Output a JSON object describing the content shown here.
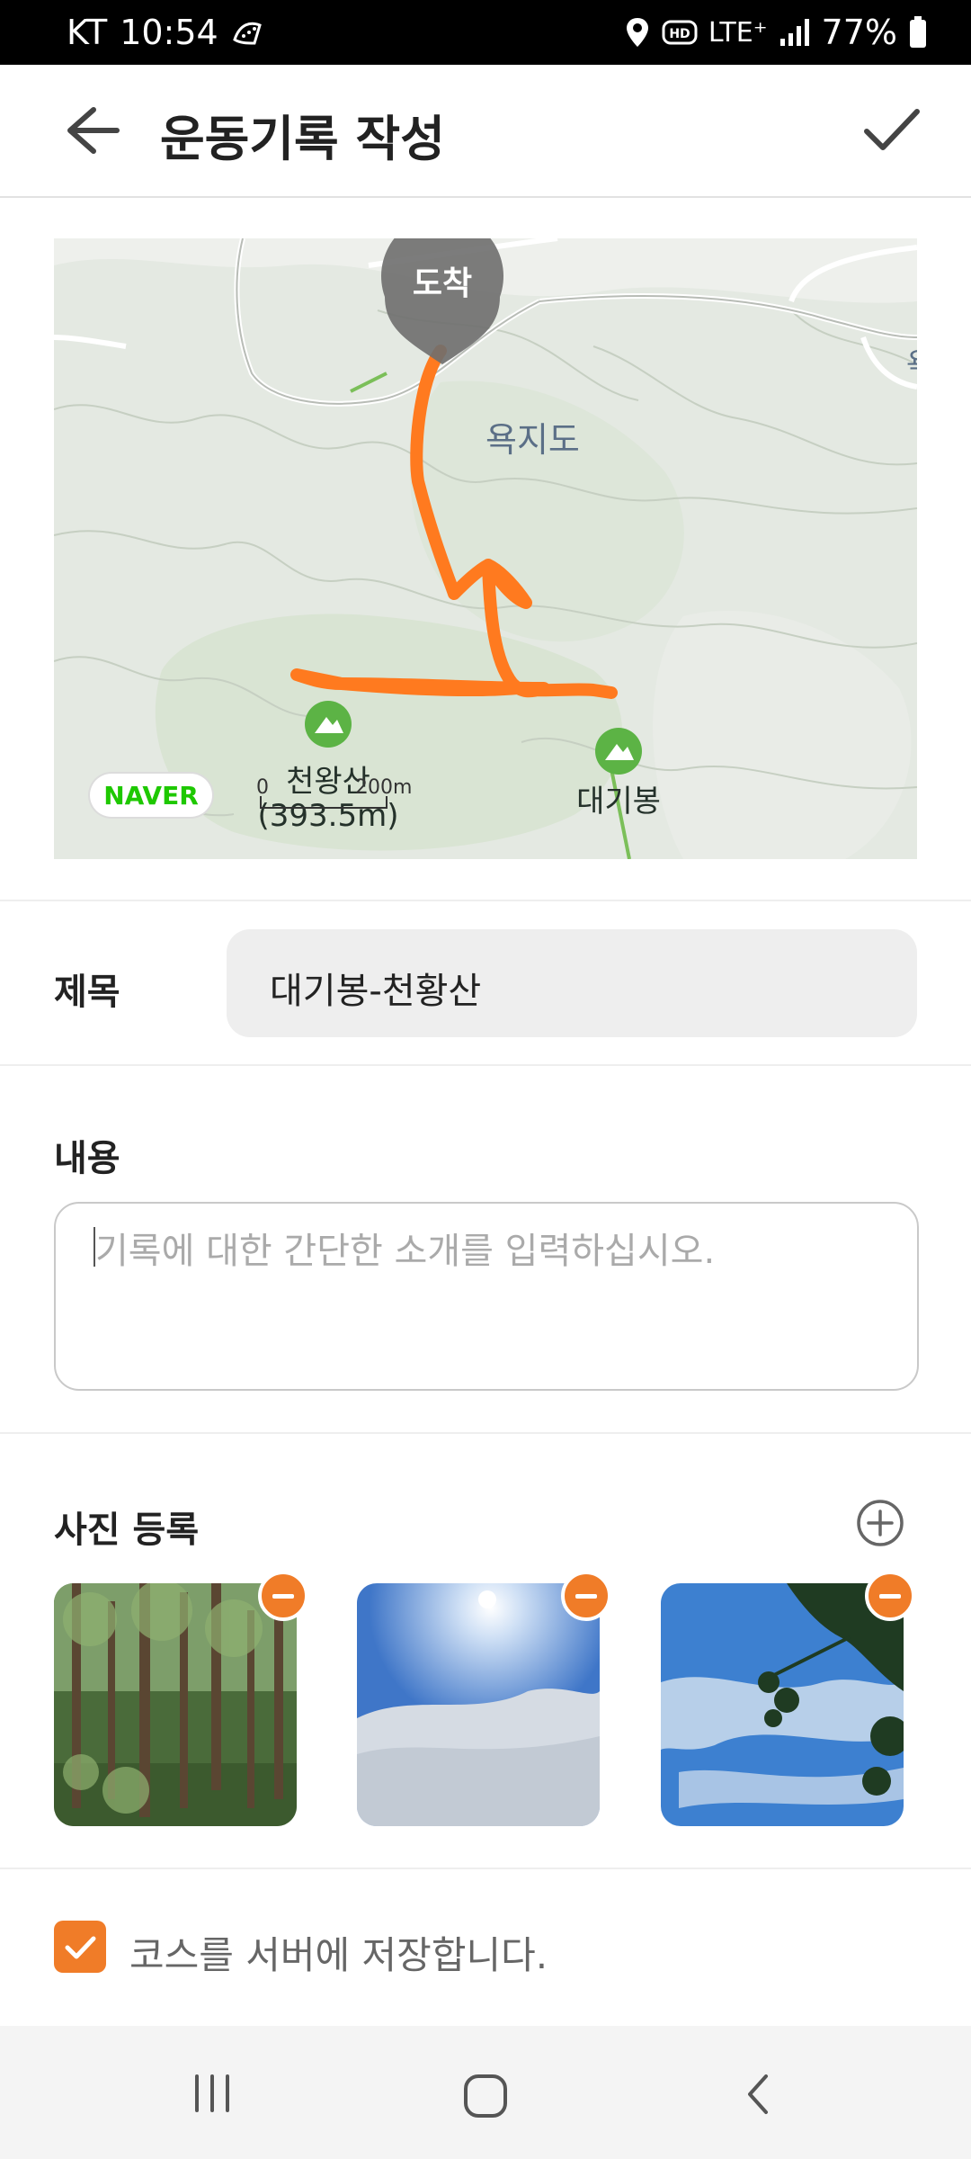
{
  "status": {
    "carrier": "KT",
    "time": "10:54",
    "network": "LTE⁺",
    "battery": "77%"
  },
  "header": {
    "title": "운동기록 작성"
  },
  "map": {
    "labels": {
      "arrival": "도착",
      "area": "욕지도",
      "peak1": "천왕산",
      "peak1_height": "(393.5m)",
      "peak2": "대기봉",
      "scale_zero": "0",
      "scale_dist": "200m",
      "partial": "욕",
      "logo": "NAVER"
    },
    "colors": {
      "route": "#ff7a1f",
      "peak_marker": "#5cb345"
    }
  },
  "form": {
    "title_label": "제목",
    "title_value": "대기봉-천황산",
    "content_label": "내용",
    "content_placeholder": "기록에 대한 간단한 소개를 입력하십시오.",
    "photos_label": "사진 등록",
    "save_course_label": "코스를 서버에 저장합니다."
  },
  "colors": {
    "accent": "#f07c28"
  }
}
